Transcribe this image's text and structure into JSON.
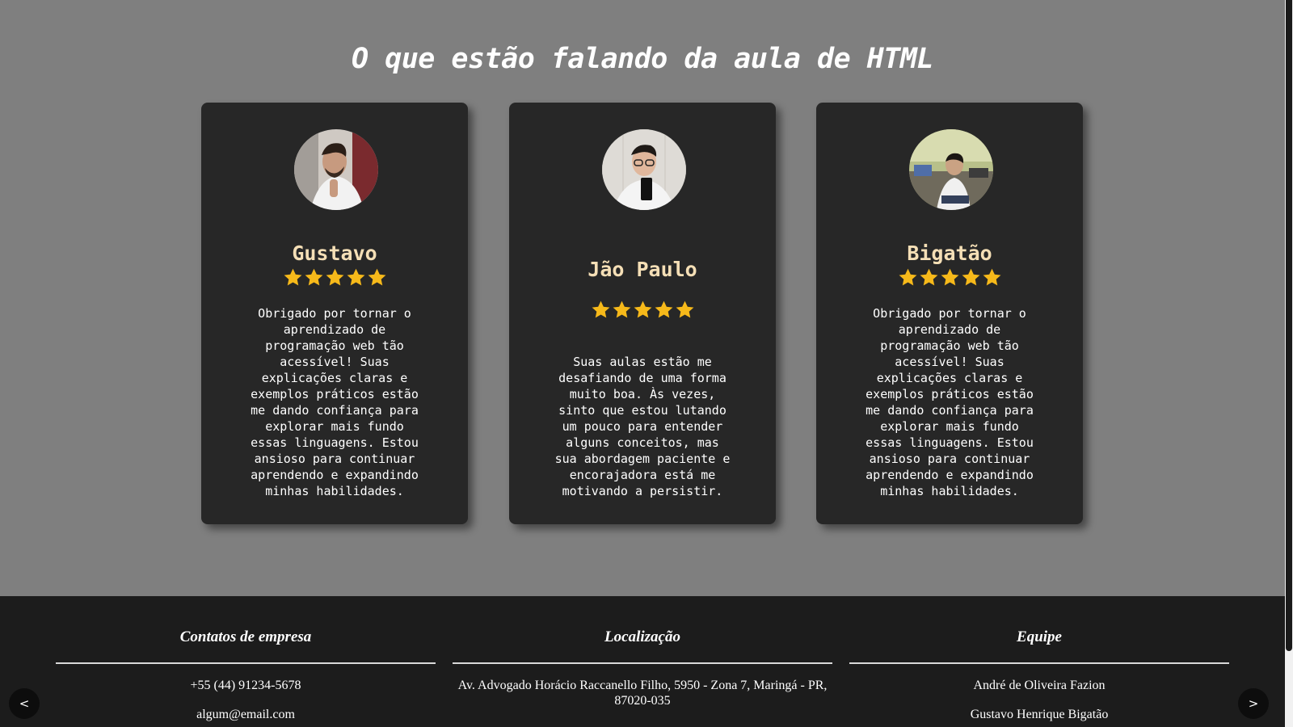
{
  "section_title": "O que estão falando da aula de HTML",
  "testimonials": [
    {
      "name": "Gustavo",
      "rating": 5,
      "text": "Obrigado por tornar o aprendizado de programação web tão acessível! Suas explicações claras e exemplos práticos estão me dando confiança para explorar mais fundo essas linguagens. Estou ansioso para continuar aprendendo e expandindo minhas habilidades."
    },
    {
      "name": "Jão Paulo",
      "rating": 5,
      "text": "Suas aulas estão me desafiando de uma forma muito boa. Às vezes, sinto que estou lutando um pouco para entender alguns conceitos, mas sua abordagem paciente e encorajadora está me motivando a persistir."
    },
    {
      "name": "Bigatão",
      "rating": 5,
      "text": "Obrigado por tornar o aprendizado de programação web tão acessível! Suas explicações claras e exemplos práticos estão me dando confiança para explorar mais fundo essas linguagens. Estou ansioso para continuar aprendendo e expandindo minhas habilidades."
    }
  ],
  "footer": {
    "contacts": {
      "title": "Contatos de empresa",
      "phone": "+55 (44) 91234-5678",
      "email": "algum@email.com"
    },
    "location": {
      "title": "Localização",
      "address": "Av. Advogado Horácio Raccanello Filho, 5950 - Zona 7, Maringá - PR, 87020-035"
    },
    "team": {
      "title": "Equipe",
      "members": [
        "André de Oliveira Fazion",
        "Gustavo Henrique Bigatão"
      ]
    }
  },
  "nav": {
    "prev": "<",
    "next": ">"
  },
  "colors": {
    "background": "#7f7f7f",
    "card": "#272727",
    "name": "#f5dfb6",
    "star": "#f6b91a",
    "footer": "#1c1c1c"
  },
  "icons": {
    "star": "star-icon",
    "avatar": "avatar-photo"
  }
}
